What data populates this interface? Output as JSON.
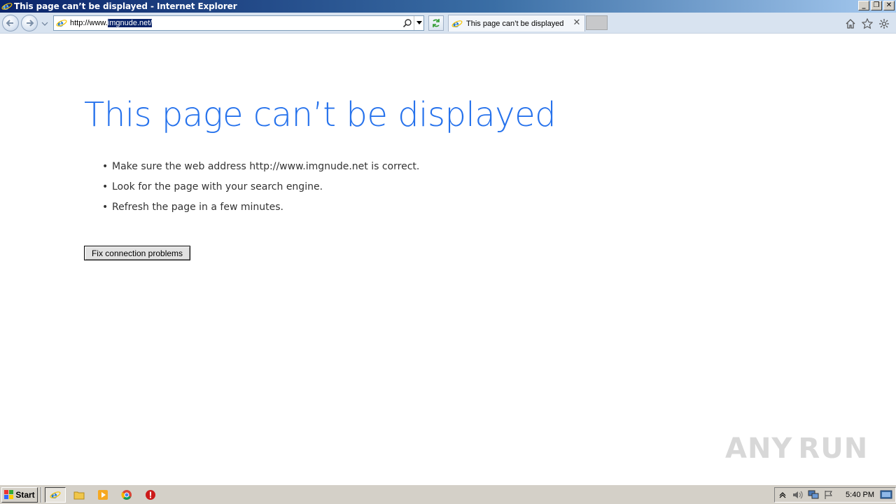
{
  "window": {
    "title": "This page can’t be displayed - Internet Explorer",
    "minimize_glyph": "_",
    "restore_glyph": "❐",
    "close_glyph": "✕"
  },
  "address_bar": {
    "url_prefix": "http://www.",
    "url_selected": "imgnude.net/"
  },
  "tabs": [
    {
      "label": "This page can’t be displayed",
      "close_glyph": "✕"
    }
  ],
  "page": {
    "heading": "This page can’t be displayed",
    "tips": [
      "Make sure the web address http://www.imgnude.net is correct.",
      "Look for the page with your search engine.",
      "Refresh the page in a few minutes."
    ],
    "bullet": "•",
    "fix_button_label": "Fix connection problems"
  },
  "watermark": {
    "left": "ANY",
    "right": "RUN"
  },
  "taskbar": {
    "start_label": "Start",
    "clock": "5:40 PM"
  },
  "colors": {
    "heading_blue": "#2672ec",
    "selection": "#0a246a",
    "taskbar": "#d4d0c8"
  }
}
